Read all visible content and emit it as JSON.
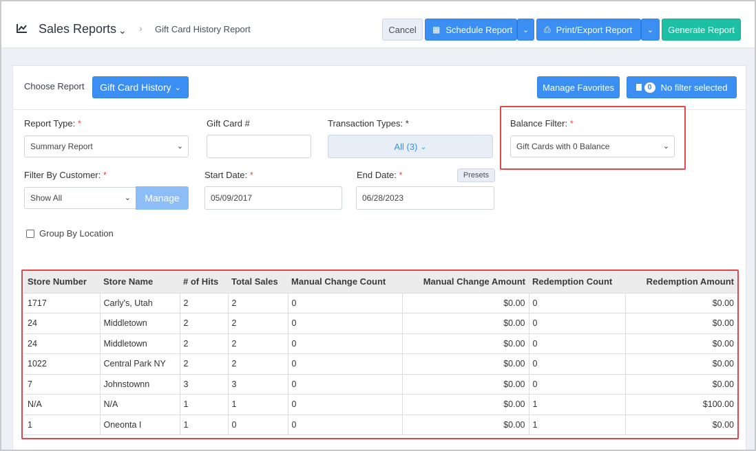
{
  "header": {
    "title": "Sales Reports",
    "breadcrumb": "Gift Card History Report",
    "cancel_label": "Cancel",
    "schedule_label": "Schedule Report",
    "print_label": "Print/Export Report",
    "generate_label": "Generate Report"
  },
  "toolbar": {
    "choose_label": "Choose Report",
    "report_button": "Gift Card History",
    "favorites_button": "Manage Favorites",
    "filter_count": "0",
    "filter_label": "No filter selected"
  },
  "form": {
    "report_type_label": "Report Type:",
    "report_type_value": "Summary Report",
    "gift_card_label": "Gift Card #",
    "gift_card_value": "",
    "transaction_types_label": "Transaction Types: *",
    "transaction_types_value": "All (3)",
    "balance_filter_label": "Balance Filter:",
    "balance_filter_value": "Gift Cards with 0 Balance",
    "customer_label": "Filter By Customer:",
    "customer_value": "Show All",
    "manage_label": "Manage",
    "start_date_label": "Start Date:",
    "start_date_value": "05/09/2017",
    "end_date_label": "End Date:",
    "end_date_value": "06/28/2023",
    "presets_label": "Presets",
    "group_by_location_label": "Group By Location",
    "group_by_location_checked": false,
    "required_mark": "*"
  },
  "table": {
    "columns": [
      "Store Number",
      "Store Name",
      "# of Hits",
      "Total Sales",
      "Manual Change Count",
      "Manual Change Amount",
      "Redemption Count",
      "Redemption Amount"
    ],
    "rows": [
      [
        "1717",
        "Carly's, Utah",
        "2",
        "2",
        "0",
        "$0.00",
        "0",
        "$0.00"
      ],
      [
        "24",
        "Middletown",
        "2",
        "2",
        "0",
        "$0.00",
        "0",
        "$0.00"
      ],
      [
        "24",
        "Middletown",
        "2",
        "2",
        "0",
        "$0.00",
        "0",
        "$0.00"
      ],
      [
        "1022",
        "Central Park NY",
        "2",
        "2",
        "0",
        "$0.00",
        "0",
        "$0.00"
      ],
      [
        "7",
        "Johnstownn",
        "3",
        "3",
        "0",
        "$0.00",
        "0",
        "$0.00"
      ],
      [
        "N/A",
        "N/A",
        "1",
        "1",
        "0",
        "$0.00",
        "1",
        "$100.00"
      ],
      [
        "1",
        "Oneonta I",
        "1",
        "0",
        "0",
        "$0.00",
        "1",
        "$0.00"
      ]
    ]
  },
  "colors": {
    "primary": "#3b8ff3",
    "teal": "#1ec0a3",
    "highlight": "#e0474c"
  }
}
